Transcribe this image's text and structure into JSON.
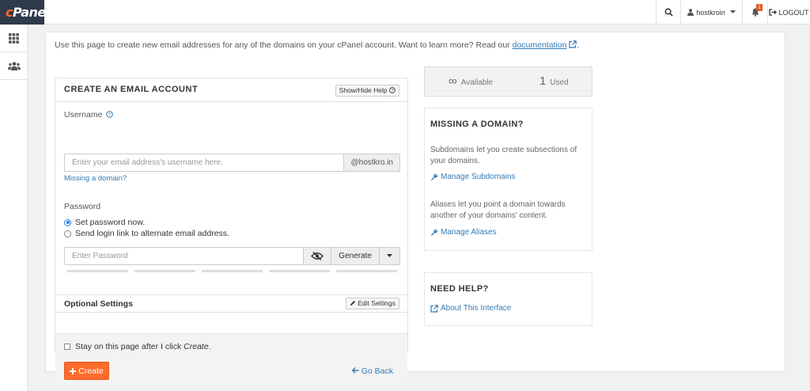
{
  "topbar": {
    "logo": {
      "prefix": "c",
      "rest": "Panel"
    },
    "user": "hostkroin",
    "notifications_count": "1",
    "logout": "LOGOUT"
  },
  "intro": {
    "text": "Use this page to create new email addresses for any of the domains on your cPanel account. Want to learn more? Read our",
    "link": "documentation",
    "trailing": "."
  },
  "create_form": {
    "title": "CREATE AN EMAIL ACCOUNT",
    "help_button": "Show/Hide Help",
    "username_label": "Username",
    "username_placeholder": "Enter your email address's username here.",
    "domain_addon": "@hostkro.in",
    "missing_domain_link": "Missing a domain?",
    "password_label": "Password",
    "radio_set_now": "Set password now.",
    "radio_send_link": "Send login link to alternate email address.",
    "password_placeholder": "Enter Password",
    "generate_button": "Generate",
    "optional_settings_title": "Optional Settings",
    "edit_settings_button": "Edit Settings",
    "stay_checkbox_prefix": "Stay on this page after I click ",
    "stay_checkbox_emph": "Create",
    "stay_checkbox_suffix": ".",
    "create_button": "Create",
    "go_back_link": "Go Back"
  },
  "stats": {
    "available_value": "∞",
    "available_label": "Available",
    "used_value": "1",
    "used_label": "Used"
  },
  "missing_domain_box": {
    "title": "MISSING A DOMAIN?",
    "subdomains_text": "Subdomains let you create subsections of your domains.",
    "subdomains_link": "Manage Subdomains",
    "aliases_text": "Aliases let you point a domain towards another of your domains' content.",
    "aliases_link": "Manage Aliases"
  },
  "help_box": {
    "title": "NEED HELP?",
    "link": "About This Interface"
  },
  "colors": {
    "accent": "#ff6c2c",
    "link": "#337ab7",
    "logo_bg": "#2f3a4a"
  }
}
